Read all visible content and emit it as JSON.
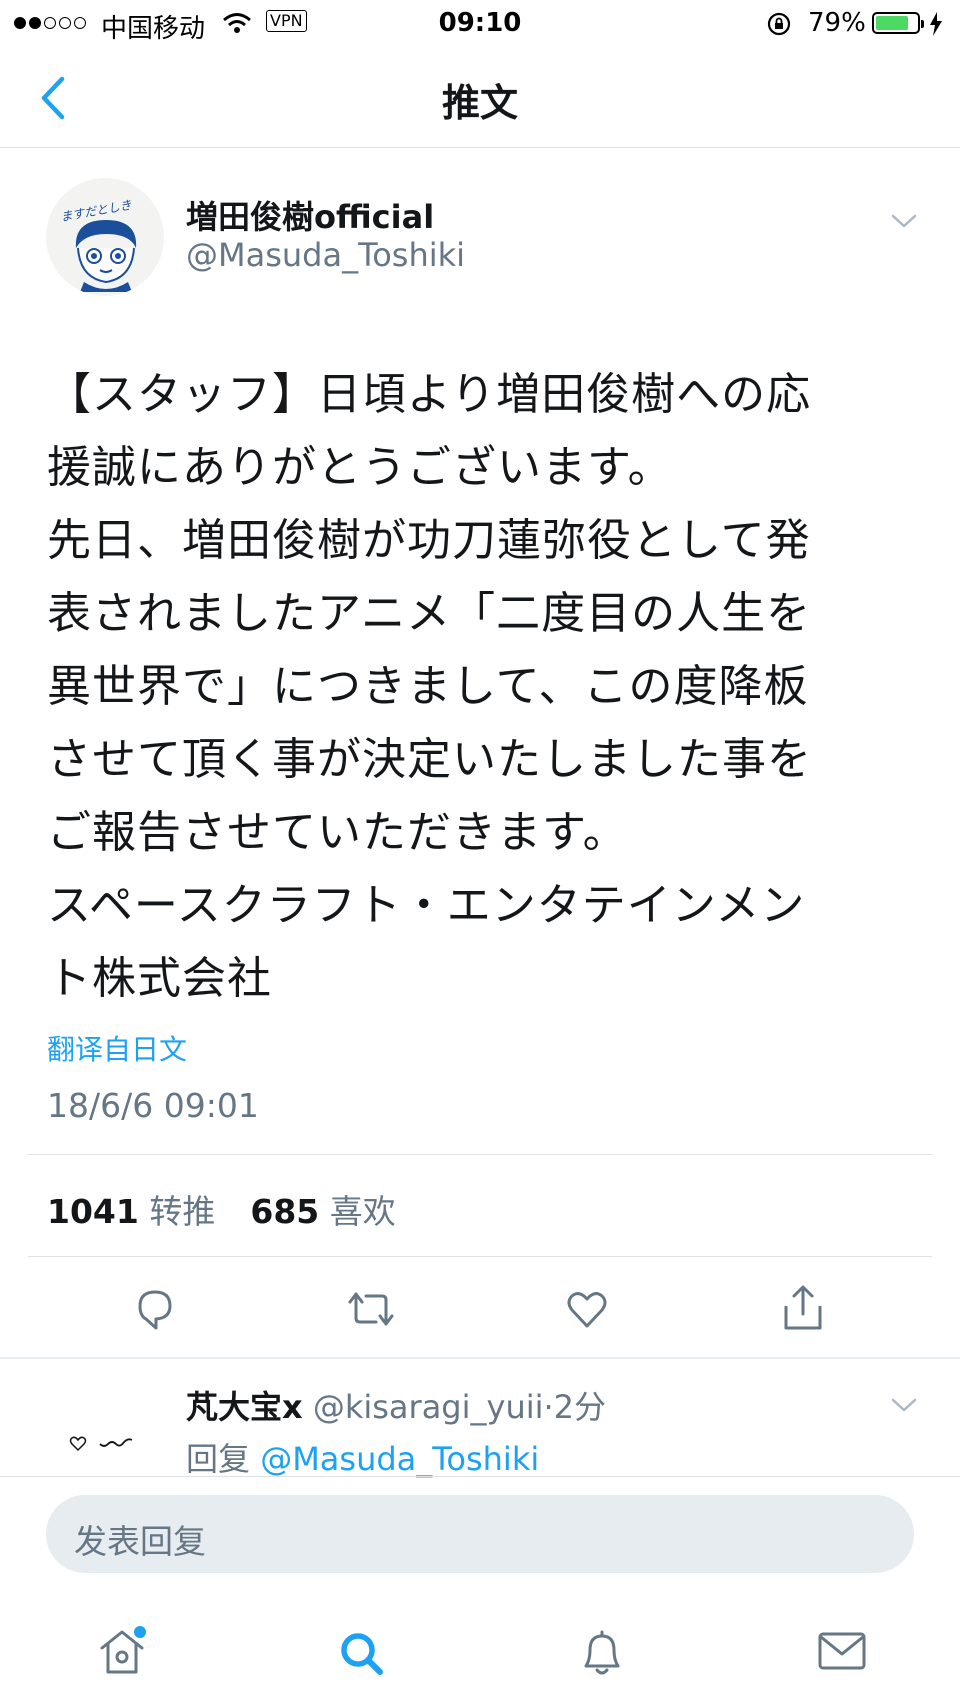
{
  "status_bar": {
    "carrier": "中国移动",
    "vpn": "VPN",
    "time": "09:10",
    "battery_percent": "79%",
    "battery_level": 0.79,
    "signal_bars_filled": 2,
    "signal_bars_total": 5,
    "battery_color": "#4cd964"
  },
  "header": {
    "back_icon": "chevron-left-icon",
    "title": "推文"
  },
  "tweet": {
    "display_name": "増田俊樹official",
    "handle": "@Masuda_Toshiki",
    "avatar_text": "ますだとしき",
    "lines": [
      "【スタッフ】日頃より増田俊樹への応",
      "援誠にありがとうございます。",
      "先日、増田俊樹が功刀蓮弥役として発",
      "表されましたアニメ「二度目の人生を",
      "異世界で」につきまして、この度降板",
      "させて頂く事が決定いたしました事を",
      "ご報告させていただきます。",
      "スペースクラフト・エンタテインメン",
      "ト株式会社"
    ],
    "translate_link": "翻译自日文",
    "timestamp": "18/6/6 09:01",
    "retweet_count": "1041",
    "retweet_label": "转推",
    "like_count": "685",
    "like_label": "喜欢"
  },
  "reply": {
    "display_name": "芃大宝x",
    "handle": "@kisaragi_yuii",
    "time_ago": "·2分",
    "reply_prefix": "回复",
    "reply_target": "@Masuda_Toshiki"
  },
  "compose": {
    "placeholder": "发表回复"
  },
  "tab_bar": {
    "tabs": [
      "home-icon",
      "search-icon",
      "notifications-icon",
      "messages-icon"
    ],
    "active": "search-icon",
    "accent": "#1da1f2"
  }
}
